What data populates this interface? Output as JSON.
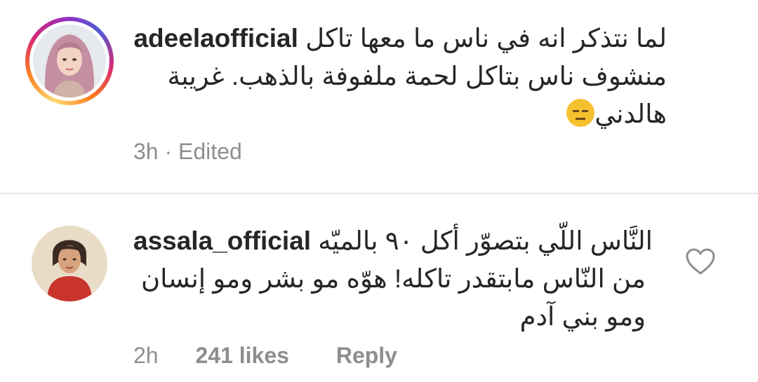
{
  "comments": [
    {
      "username": "adeelaofficial",
      "text_line1": "لما نتذكر انه في ناس ما معها تاكل",
      "text_line2": "منشوف ناس بتاكل لحمة ملفوفة بالذهب. غريبة",
      "text_line3": "هالدني",
      "time": "3h",
      "edited": "· Edited",
      "emoji_icon": "expressionless-face-emoji"
    },
    {
      "username": "assala_official",
      "text_line1": "النَّاس اللّي بتصوّر أكل ٩٠ بالميّه",
      "text_line2": "من النّاس مابتقدر تاكله! هوّه مو بشر ومو إنسان",
      "text_line3": "ومو بني آدم",
      "time": "2h",
      "likes": "241 likes",
      "reply": "Reply",
      "like_icon": "heart-outline-icon"
    }
  ],
  "colors": {
    "text": "#262626",
    "muted": "#8e8e8e",
    "divider": "#e3e3e3",
    "story_ring": [
      "#feda75",
      "#fa7e1e",
      "#d62976",
      "#962fbf"
    ]
  }
}
